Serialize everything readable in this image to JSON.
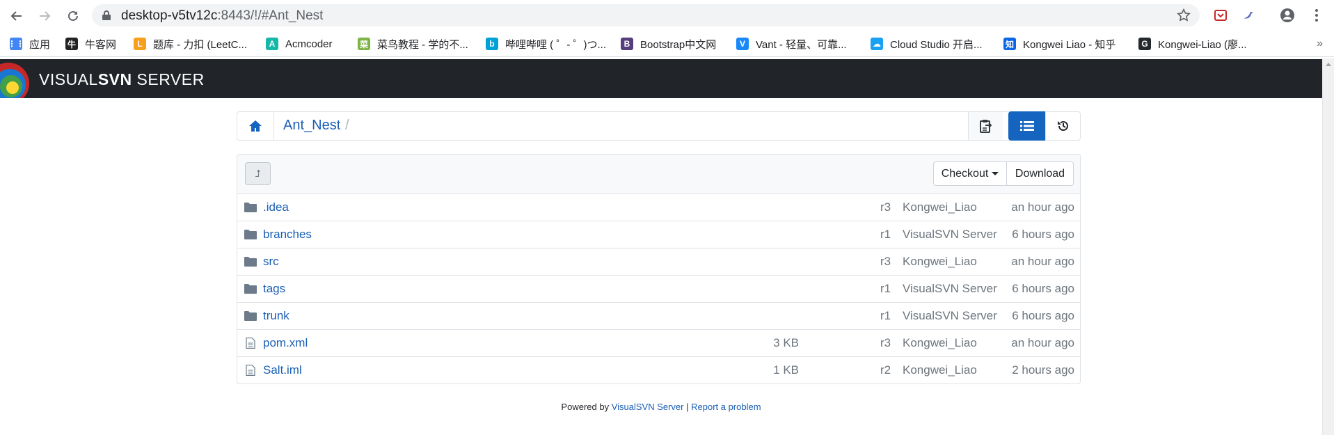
{
  "browser": {
    "url_host": "desktop-v5tv12c",
    "url_rest": ":8443/!/#Ant_Nest",
    "bookmarks": [
      {
        "label": "应用",
        "icon": "apps-grid-icon",
        "color": "#4285f4"
      },
      {
        "label": "牛客网",
        "icon": "nowcoder-icon",
        "color": "#222222"
      },
      {
        "label": "题库 - 力扣 (LeetC...",
        "icon": "leetcode-icon",
        "color": "#f89f1b"
      },
      {
        "label": "Acmcoder",
        "icon": "acmcoder-icon",
        "color": "#13b8a8"
      },
      {
        "label": "菜鸟教程 - 学的不...",
        "icon": "runoob-icon",
        "color": "#7cb342"
      },
      {
        "label": "哔哩哔哩 ( ゜- ゜)つ...",
        "icon": "bilibili-icon",
        "color": "#00a1d6"
      },
      {
        "label": "Bootstrap中文网",
        "icon": "bootstrap-icon",
        "color": "#563d7c"
      },
      {
        "label": "Vant - 轻量、可靠...",
        "icon": "vant-icon",
        "color": "#1989fa"
      },
      {
        "label": "Cloud Studio 开启...",
        "icon": "cloud-studio-icon",
        "color": "#19a1f2"
      },
      {
        "label": "Kongwei Liao - 知乎",
        "icon": "zhihu-icon",
        "color": "#0a66e8"
      },
      {
        "label": "Kongwei-Liao (廖...",
        "icon": "github-icon",
        "color": "#24292e"
      }
    ],
    "more_label": "»"
  },
  "header": {
    "brand_light": "VISUAL",
    "brand_bold": "SVN",
    "brand_tail": " SERVER"
  },
  "breadcrumb": {
    "repo": "Ant_Nest",
    "separator": "/"
  },
  "panel": {
    "up_label": "⮥",
    "checkout_label": "Checkout",
    "download_label": "Download"
  },
  "files": [
    {
      "name": ".idea",
      "type": "dir",
      "size": "",
      "rev": "r3",
      "author": "Kongwei_Liao",
      "date": "an hour ago"
    },
    {
      "name": "branches",
      "type": "dir",
      "size": "",
      "rev": "r1",
      "author": "VisualSVN Server",
      "date": "6 hours ago"
    },
    {
      "name": "src",
      "type": "dir",
      "size": "",
      "rev": "r3",
      "author": "Kongwei_Liao",
      "date": "an hour ago"
    },
    {
      "name": "tags",
      "type": "dir",
      "size": "",
      "rev": "r1",
      "author": "VisualSVN Server",
      "date": "6 hours ago"
    },
    {
      "name": "trunk",
      "type": "dir",
      "size": "",
      "rev": "r1",
      "author": "VisualSVN Server",
      "date": "6 hours ago"
    },
    {
      "name": "pom.xml",
      "type": "file",
      "size": "3 KB",
      "rev": "r3",
      "author": "Kongwei_Liao",
      "date": "an hour ago"
    },
    {
      "name": "Salt.iml",
      "type": "file",
      "size": "1 KB",
      "rev": "r2",
      "author": "Kongwei_Liao",
      "date": "2 hours ago"
    }
  ],
  "footer": {
    "powered_by": "Powered by ",
    "product": "VisualSVN Server",
    "sep": " | ",
    "report": "Report a problem"
  }
}
